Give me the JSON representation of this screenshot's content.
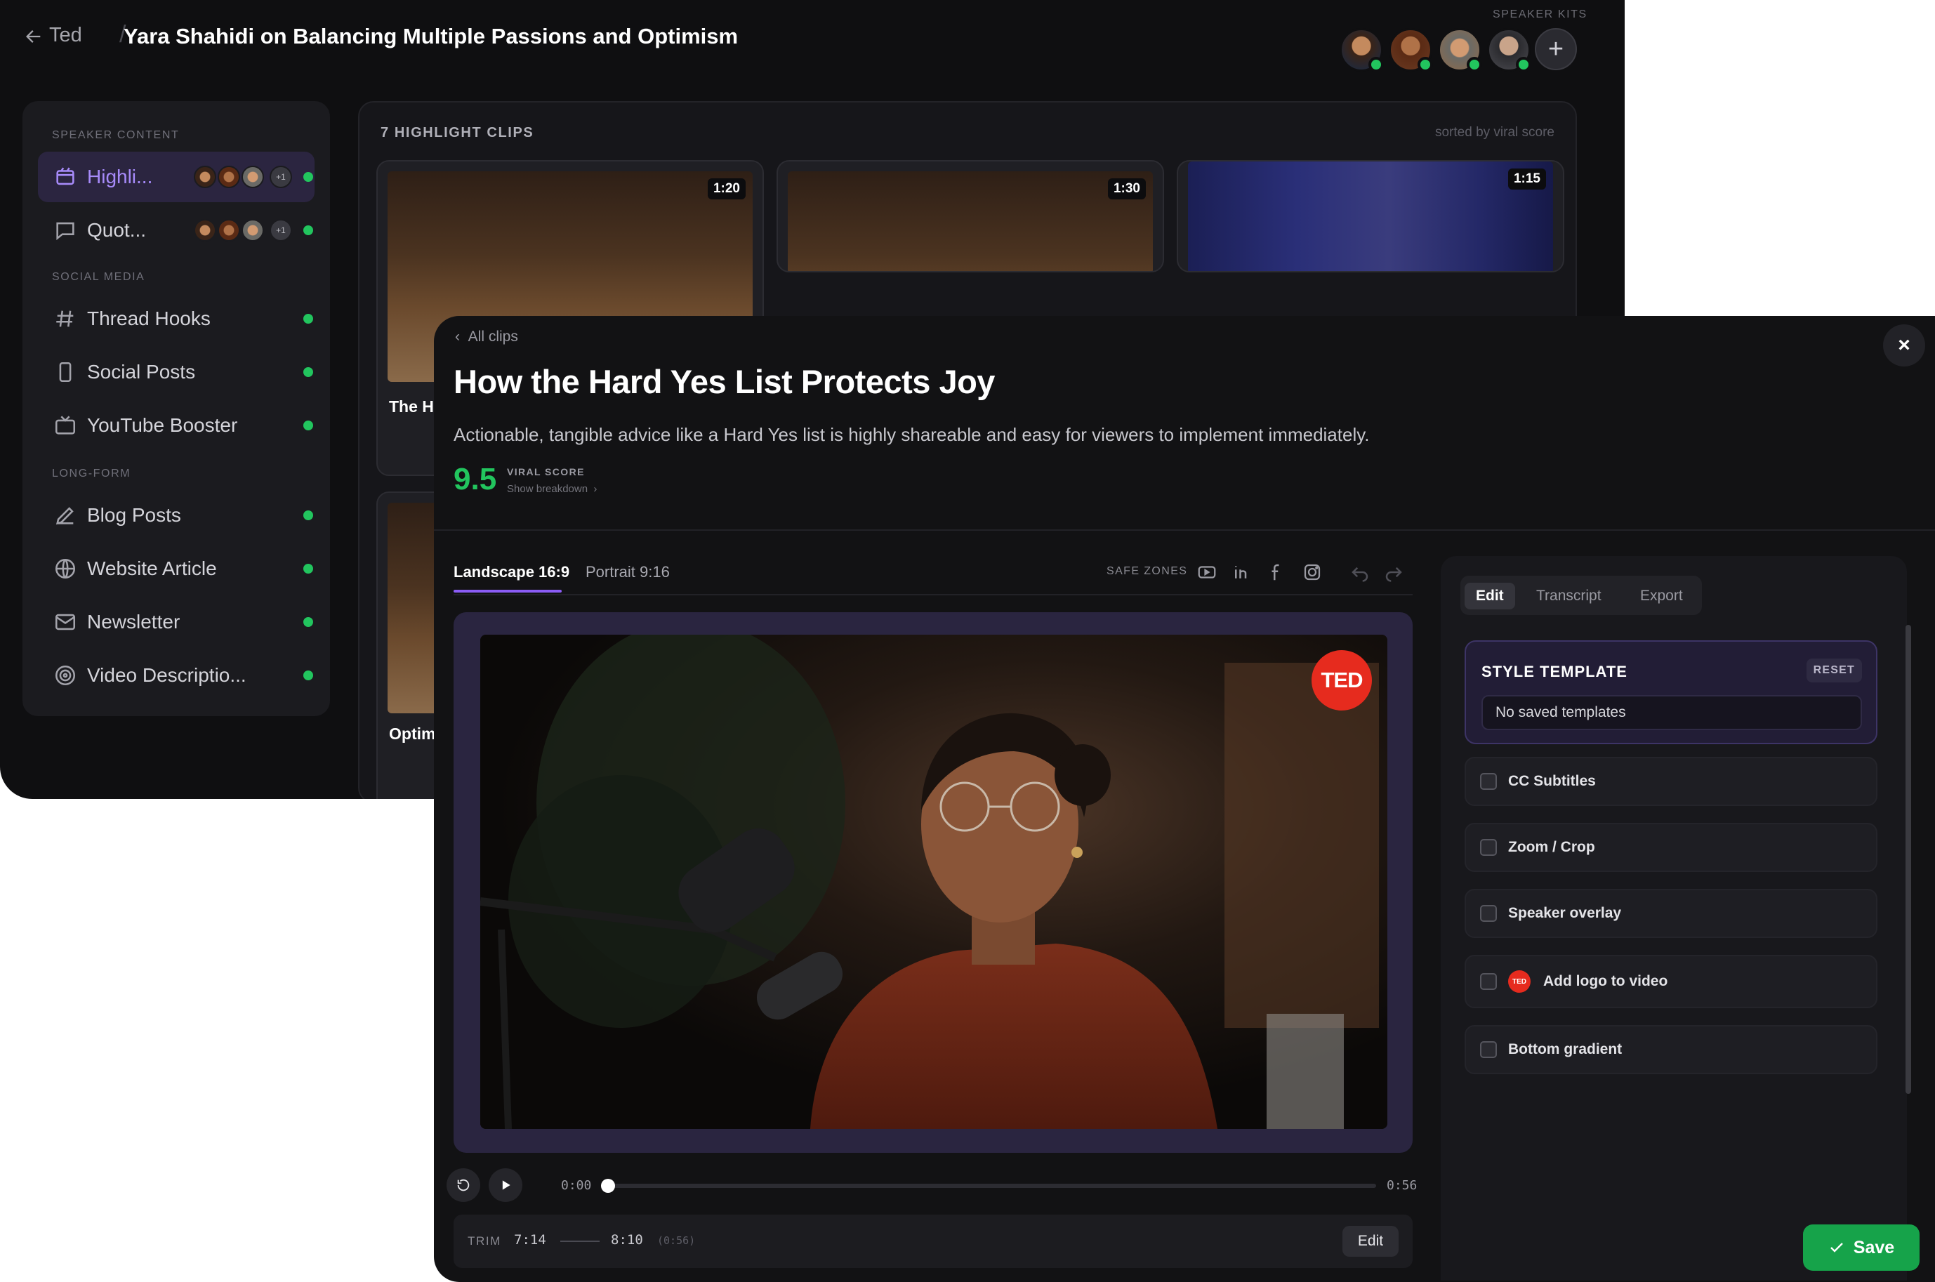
{
  "breadcrumb": {
    "root": "Ted",
    "separator": "/",
    "title": "Yara Shahidi on Balancing Multiple Passions and Optimism"
  },
  "speaker_kits": {
    "label": "SPEAKER KITS",
    "add": "+"
  },
  "sidebar": {
    "sections": [
      {
        "label": "SPEAKER CONTENT"
      },
      {
        "label": "SOCIAL MEDIA"
      },
      {
        "label": "LONG-FORM"
      }
    ],
    "items": [
      {
        "label": "Highli...",
        "icon": "highlights-icon"
      },
      {
        "label": "Quot...",
        "icon": "quote-icon"
      },
      {
        "label": "Thread Hooks",
        "icon": "hash-icon"
      },
      {
        "label": "Social Posts",
        "icon": "phone-icon"
      },
      {
        "label": "YouTube Booster",
        "icon": "tv-icon"
      },
      {
        "label": "Blog Posts",
        "icon": "pen-icon"
      },
      {
        "label": "Website Article",
        "icon": "globe-icon"
      },
      {
        "label": "Newsletter",
        "icon": "mail-icon"
      },
      {
        "label": "Video Descriptio...",
        "icon": "target-icon"
      }
    ],
    "more_badge": "+1"
  },
  "clips": {
    "count_label": "7 HIGHLIGHT CLIPS",
    "sort_label": "sorted by viral score",
    "cards": [
      {
        "duration": "1:20",
        "title": "The H"
      },
      {
        "duration": "1:30",
        "title": ""
      },
      {
        "duration": "1:15",
        "title": ""
      },
      {
        "duration": "",
        "title": "Optim"
      }
    ]
  },
  "modal": {
    "back_link": "All clips",
    "title": "How the Hard Yes List Protects Joy",
    "description": "Actionable, tangible advice like a Hard Yes list is highly shareable and easy for viewers to implement immediately.",
    "viral_score": "9.5",
    "viral_label": "VIRAL SCORE",
    "breakdown_link": "Show breakdown",
    "close": "×",
    "formats": {
      "landscape": "Landscape 16:9",
      "portrait": "Portrait 9:16"
    },
    "safe_zones_label": "SAFE ZONES",
    "ted_logo": "TED",
    "player": {
      "current_time": "0:00",
      "total_time": "0:56",
      "progress": 0.0
    },
    "trim": {
      "label": "TRIM",
      "start": "7:14",
      "end": "8:10",
      "duration": "(0:56)",
      "edit": "Edit"
    }
  },
  "right_panel": {
    "tabs": [
      "Edit",
      "Transcript",
      "Export"
    ],
    "style_template": {
      "title": "STYLE TEMPLATE",
      "reset": "RESET",
      "selected": "No saved templates"
    },
    "options": [
      {
        "label": "CC Subtitles"
      },
      {
        "label": "Zoom / Crop"
      },
      {
        "label": "Speaker overlay"
      },
      {
        "label": "Add logo to video",
        "badge": "TED"
      },
      {
        "label": "Bottom gradient"
      }
    ]
  },
  "save": {
    "label": "Save"
  },
  "colors": {
    "accent": "#8b5cf6",
    "success": "#22c55e",
    "ted_red": "#e62b1e",
    "save_green": "#16a34a"
  }
}
